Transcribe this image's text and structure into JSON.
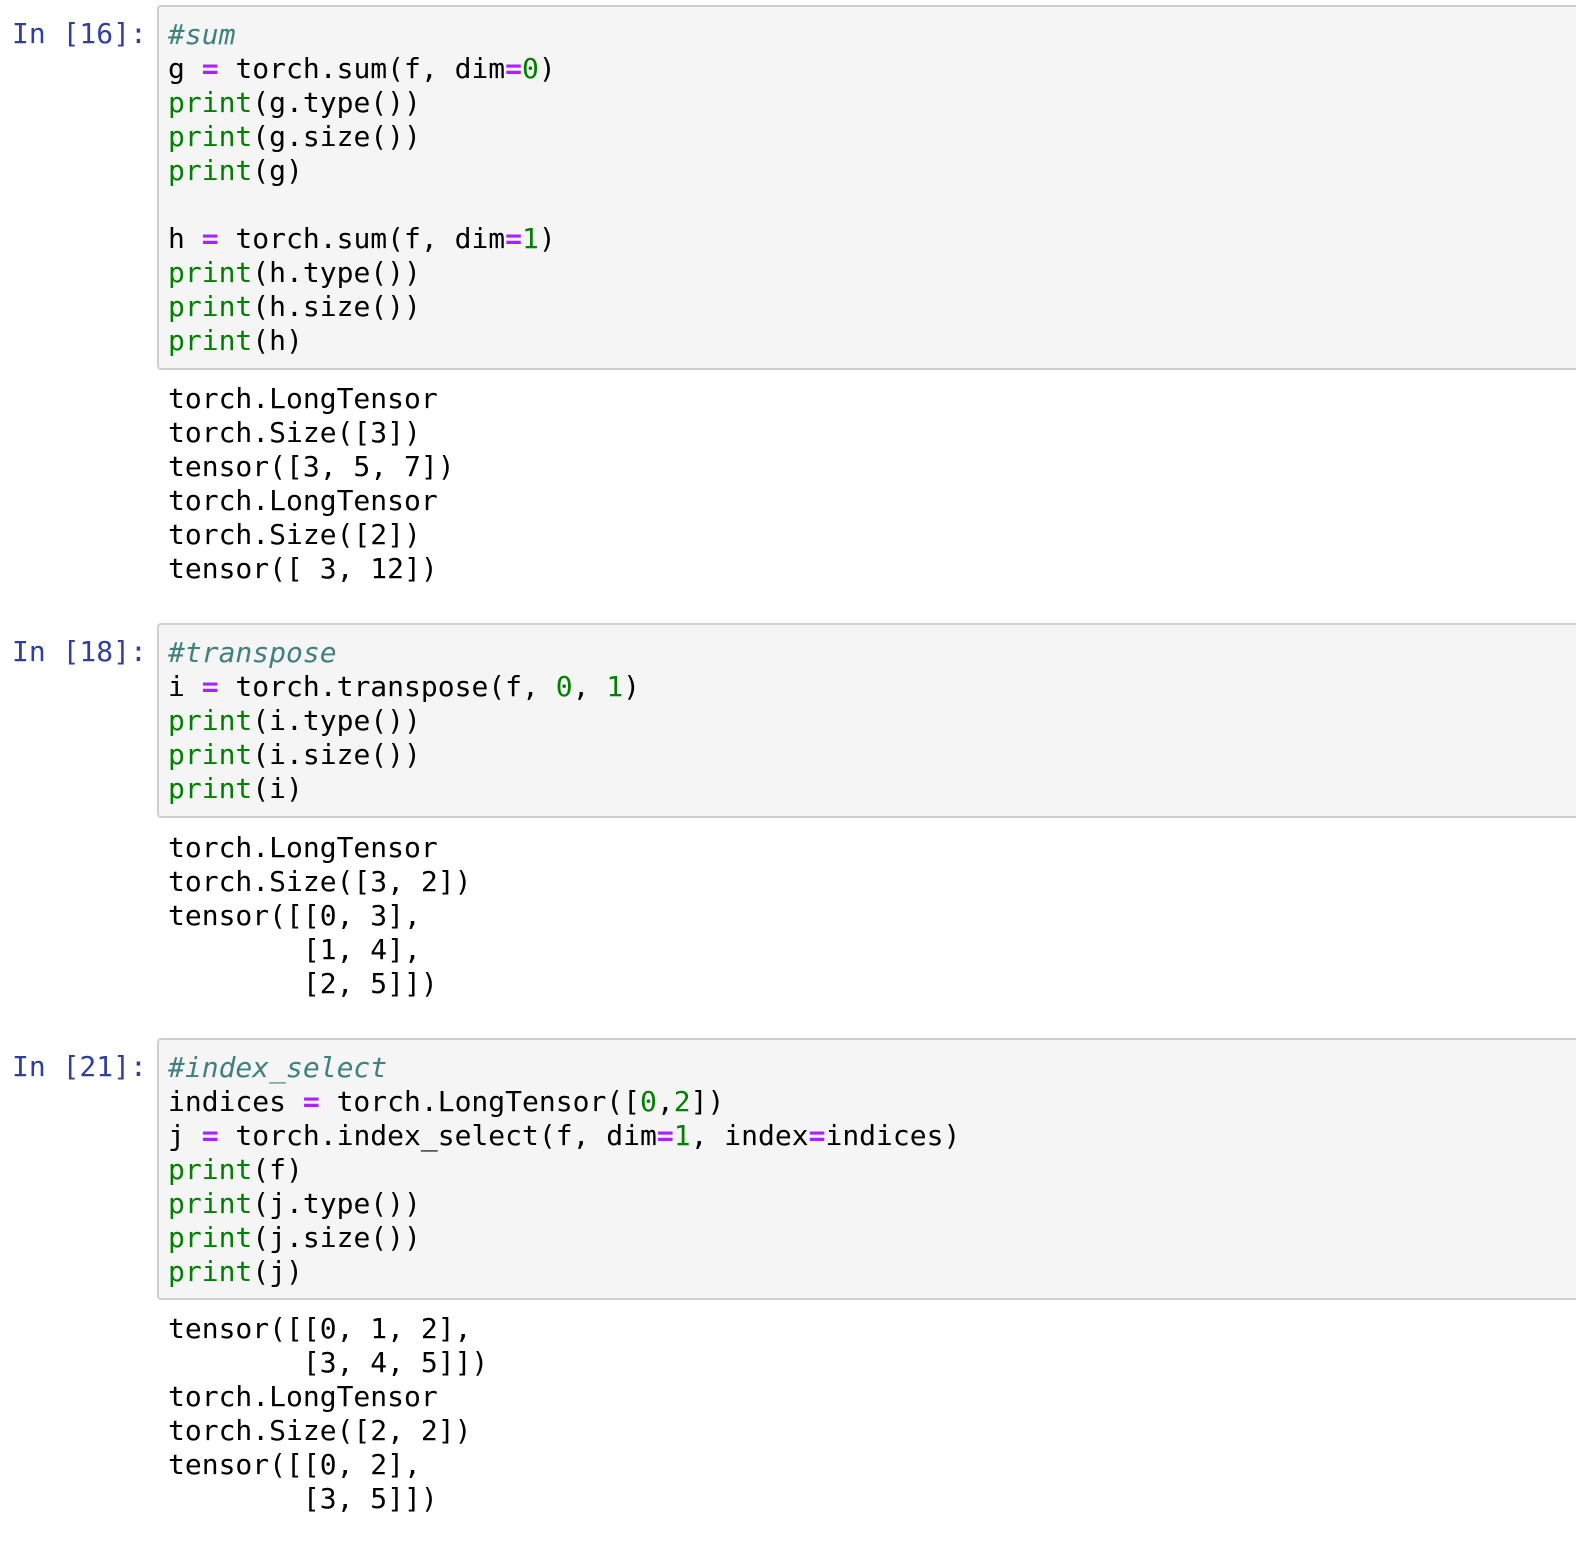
{
  "colors": {
    "prompt": "#303f9f",
    "input_background": "#f5f5f5",
    "input_border": "#cfcfcf",
    "comment": "#408080",
    "builtin": "#008000",
    "operator": "#aa22ff",
    "number": "#008000"
  },
  "cells": [
    {
      "prompt": "In [16]:",
      "code": [
        [
          {
            "t": "comment",
            "v": "#sum"
          }
        ],
        [
          {
            "t": "name",
            "v": "g "
          },
          {
            "t": "op",
            "v": "="
          },
          {
            "t": "name",
            "v": " torch.sum(f, dim"
          },
          {
            "t": "op",
            "v": "="
          },
          {
            "t": "num",
            "v": "0"
          },
          {
            "t": "name",
            "v": ")"
          }
        ],
        [
          {
            "t": "builtin",
            "v": "print"
          },
          {
            "t": "name",
            "v": "(g.type())"
          }
        ],
        [
          {
            "t": "builtin",
            "v": "print"
          },
          {
            "t": "name",
            "v": "(g.size())"
          }
        ],
        [
          {
            "t": "builtin",
            "v": "print"
          },
          {
            "t": "name",
            "v": "(g)"
          }
        ],
        [],
        [
          {
            "t": "name",
            "v": "h "
          },
          {
            "t": "op",
            "v": "="
          },
          {
            "t": "name",
            "v": " torch.sum(f, dim"
          },
          {
            "t": "op",
            "v": "="
          },
          {
            "t": "num",
            "v": "1"
          },
          {
            "t": "name",
            "v": ")"
          }
        ],
        [
          {
            "t": "builtin",
            "v": "print"
          },
          {
            "t": "name",
            "v": "(h.type())"
          }
        ],
        [
          {
            "t": "builtin",
            "v": "print"
          },
          {
            "t": "name",
            "v": "(h.size())"
          }
        ],
        [
          {
            "t": "builtin",
            "v": "print"
          },
          {
            "t": "name",
            "v": "(h)"
          }
        ]
      ],
      "output": [
        "torch.LongTensor",
        "torch.Size([3])",
        "tensor([3, 5, 7])",
        "torch.LongTensor",
        "torch.Size([2])",
        "tensor([ 3, 12])"
      ]
    },
    {
      "prompt": "In [18]:",
      "code": [
        [
          {
            "t": "comment",
            "v": "#transpose"
          }
        ],
        [
          {
            "t": "name",
            "v": "i "
          },
          {
            "t": "op",
            "v": "="
          },
          {
            "t": "name",
            "v": " torch.transpose(f, "
          },
          {
            "t": "num",
            "v": "0"
          },
          {
            "t": "name",
            "v": ", "
          },
          {
            "t": "num",
            "v": "1"
          },
          {
            "t": "name",
            "v": ")"
          }
        ],
        [
          {
            "t": "builtin",
            "v": "print"
          },
          {
            "t": "name",
            "v": "(i.type())"
          }
        ],
        [
          {
            "t": "builtin",
            "v": "print"
          },
          {
            "t": "name",
            "v": "(i.size())"
          }
        ],
        [
          {
            "t": "builtin",
            "v": "print"
          },
          {
            "t": "name",
            "v": "(i)"
          }
        ]
      ],
      "output": [
        "torch.LongTensor",
        "torch.Size([3, 2])",
        "tensor([[0, 3],",
        "        [1, 4],",
        "        [2, 5]])"
      ]
    },
    {
      "prompt": "In [21]:",
      "code": [
        [
          {
            "t": "comment",
            "v": "#index_select"
          }
        ],
        [
          {
            "t": "name",
            "v": "indices "
          },
          {
            "t": "op",
            "v": "="
          },
          {
            "t": "name",
            "v": " torch.LongTensor(["
          },
          {
            "t": "num",
            "v": "0"
          },
          {
            "t": "name",
            "v": ","
          },
          {
            "t": "num",
            "v": "2"
          },
          {
            "t": "name",
            "v": "])"
          }
        ],
        [
          {
            "t": "name",
            "v": "j "
          },
          {
            "t": "op",
            "v": "="
          },
          {
            "t": "name",
            "v": " torch.index_select(f, dim"
          },
          {
            "t": "op",
            "v": "="
          },
          {
            "t": "num",
            "v": "1"
          },
          {
            "t": "name",
            "v": ", index"
          },
          {
            "t": "op",
            "v": "="
          },
          {
            "t": "name",
            "v": "indices)"
          }
        ],
        [
          {
            "t": "builtin",
            "v": "print"
          },
          {
            "t": "name",
            "v": "(f)"
          }
        ],
        [
          {
            "t": "builtin",
            "v": "print"
          },
          {
            "t": "name",
            "v": "(j.type())"
          }
        ],
        [
          {
            "t": "builtin",
            "v": "print"
          },
          {
            "t": "name",
            "v": "(j.size())"
          }
        ],
        [
          {
            "t": "builtin",
            "v": "print"
          },
          {
            "t": "name",
            "v": "(j)"
          }
        ]
      ],
      "output": [
        "tensor([[0, 1, 2],",
        "        [3, 4, 5]])",
        "torch.LongTensor",
        "torch.Size([2, 2])",
        "tensor([[0, 2],",
        "        [3, 5]])"
      ]
    }
  ]
}
